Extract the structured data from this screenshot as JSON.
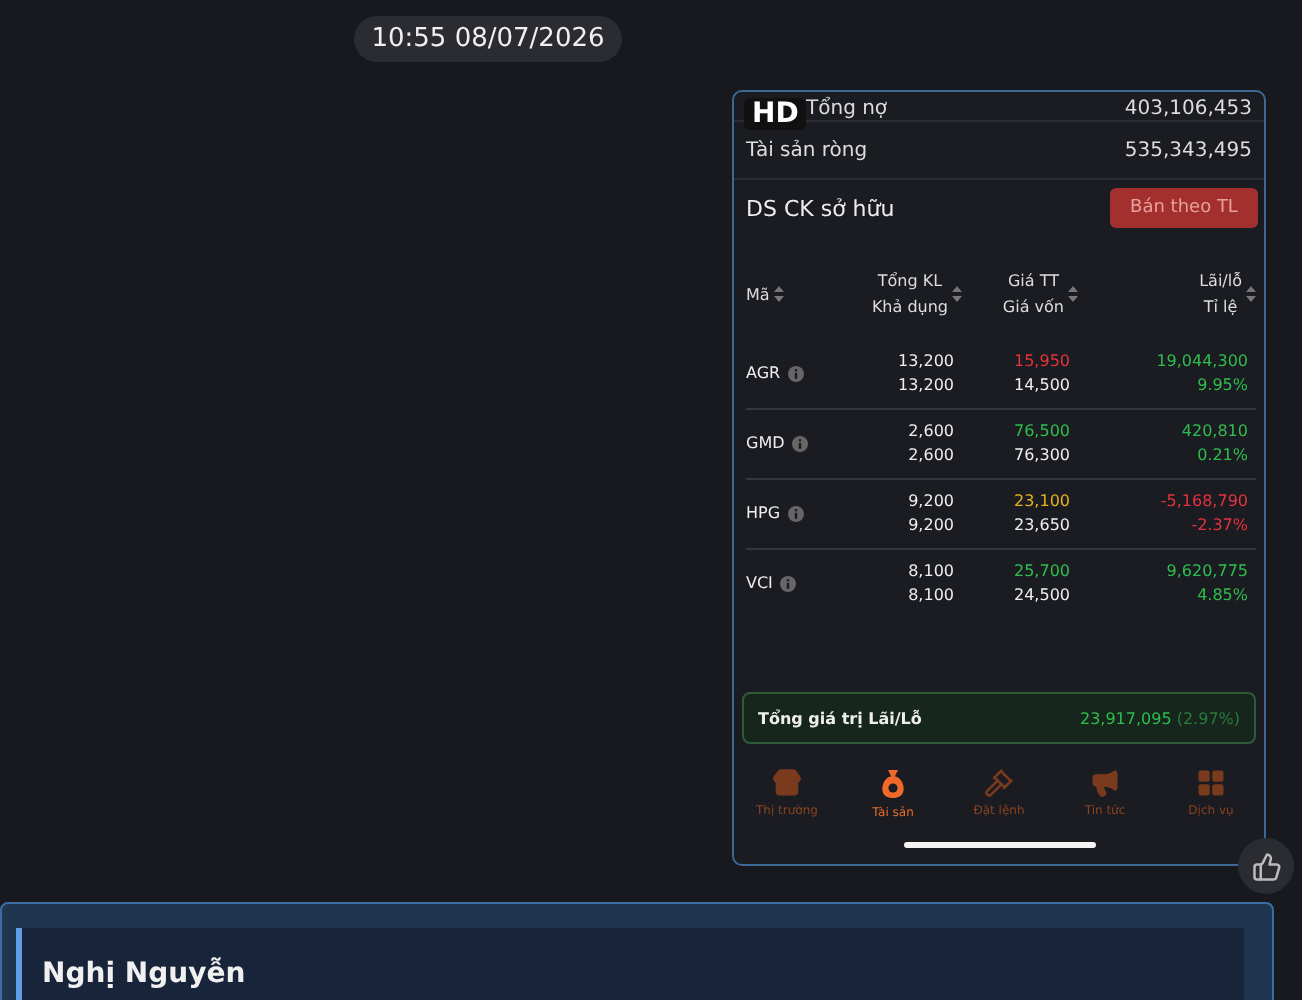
{
  "timestamp": "10:55 08/07/2026",
  "phone": {
    "badge": "HD",
    "summary": [
      {
        "label": "Tổng nợ",
        "value": "403,106,453"
      },
      {
        "label": "Tài sản ròng",
        "value": "535,343,495"
      }
    ],
    "holdings_title": "DS CK sở hữu",
    "sell_button": "Bán theo TL",
    "columns": [
      {
        "lines": [
          "Mã"
        ]
      },
      {
        "lines": [
          "Tổng KL",
          "Khả dụng"
        ]
      },
      {
        "lines": [
          "Giá TT",
          "Giá vốn"
        ]
      },
      {
        "lines": [
          "Lãi/lỗ",
          "Tỉ lệ"
        ]
      }
    ],
    "rows": [
      {
        "symbol": "AGR",
        "total": "13,200",
        "available": "13,200",
        "price": {
          "text": "15,950",
          "color": "#e5323c"
        },
        "cost": "14,500",
        "pnl": {
          "text": "19,044,300",
          "color": "#2fbe4d"
        },
        "ratio": {
          "text": "9.95%",
          "color": "#2fbe4d"
        }
      },
      {
        "symbol": "GMD",
        "total": "2,600",
        "available": "2,600",
        "price": {
          "text": "76,500",
          "color": "#2fbe4d"
        },
        "cost": "76,300",
        "pnl": {
          "text": "420,810",
          "color": "#2fbe4d"
        },
        "ratio": {
          "text": "0.21%",
          "color": "#2fbe4d"
        }
      },
      {
        "symbol": "HPG",
        "total": "9,200",
        "available": "9,200",
        "price": {
          "text": "23,100",
          "color": "#e6b11f"
        },
        "cost": "23,650",
        "pnl": {
          "text": "-5,168,790",
          "color": "#e5323c"
        },
        "ratio": {
          "text": "-2.37%",
          "color": "#e5323c"
        }
      },
      {
        "symbol": "VCI",
        "total": "8,100",
        "available": "8,100",
        "price": {
          "text": "25,700",
          "color": "#2fbe4d"
        },
        "cost": "24,500",
        "pnl": {
          "text": "9,620,775",
          "color": "#2fbe4d"
        },
        "ratio": {
          "text": "4.85%",
          "color": "#2fbe4d"
        }
      }
    ],
    "total": {
      "label": "Tổng giá trị Lãi/Lỗ",
      "value": "23,917,095",
      "percent": "(2.97%)"
    },
    "nav": [
      {
        "label": "Thị trường",
        "selected": false
      },
      {
        "label": "Tài sản",
        "selected": true
      },
      {
        "label": "Đặt lệnh",
        "selected": false
      },
      {
        "label": "Tin tức",
        "selected": false
      },
      {
        "label": "Dịch vụ",
        "selected": false
      }
    ]
  },
  "reply": {
    "author": "Nghị Nguyễn"
  }
}
